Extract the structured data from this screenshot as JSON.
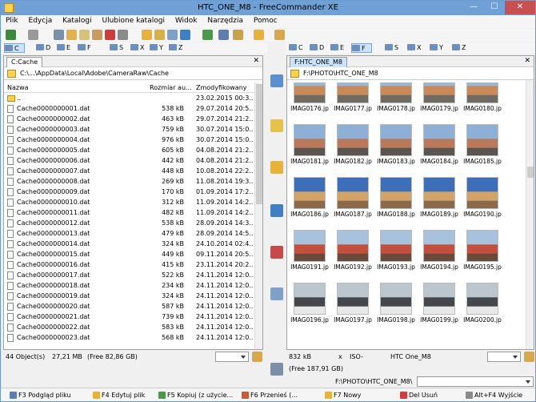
{
  "window": {
    "title": "HTC_ONE_M8 - FreeCommander XE",
    "min": "—",
    "max": "☐",
    "close": "✕"
  },
  "menu": [
    "Plik",
    "Edycja",
    "Katalogi",
    "Ulubione katalogi",
    "Widok",
    "Narzędzia",
    "Pomoc"
  ],
  "drives_left": [
    "C",
    "D",
    "E",
    "F",
    "S",
    "X",
    "Y",
    "Z"
  ],
  "drives_right": [
    "C",
    "D",
    "E",
    "F",
    "S",
    "X",
    "Y",
    "Z"
  ],
  "left": {
    "tab": "C:Cache",
    "path": "C:\\...\\AppData\\Local\\Adobe\\CameraRaw\\Cache",
    "columns": {
      "name": "Nazwa",
      "size": "Rozmiar au...",
      "modified": "Zmodyfikowany"
    },
    "rows": [
      {
        "name": "..",
        "size": "",
        "date": "23.02.2015 00:3..",
        "type": "folder"
      },
      {
        "name": "Cache0000000001.dat",
        "size": "538 kB",
        "date": "29.07.2014 20:5..",
        "type": "file"
      },
      {
        "name": "Cache0000000002.dat",
        "size": "463 kB",
        "date": "29.07.2014 21:2..",
        "type": "file"
      },
      {
        "name": "Cache0000000003.dat",
        "size": "759 kB",
        "date": "30.07.2014 15:0..",
        "type": "file"
      },
      {
        "name": "Cache0000000004.dat",
        "size": "976 kB",
        "date": "30.07.2014 15:0..",
        "type": "file"
      },
      {
        "name": "Cache0000000005.dat",
        "size": "605 kB",
        "date": "04.08.2014 21:2..",
        "type": "file"
      },
      {
        "name": "Cache0000000006.dat",
        "size": "442 kB",
        "date": "04.08.2014 21:2..",
        "type": "file"
      },
      {
        "name": "Cache0000000007.dat",
        "size": "448 kB",
        "date": "10.08.2014 22:2..",
        "type": "file"
      },
      {
        "name": "Cache0000000008.dat",
        "size": "269 kB",
        "date": "11.08.2014 19:3..",
        "type": "file"
      },
      {
        "name": "Cache0000000009.dat",
        "size": "170 kB",
        "date": "01.09.2014 17:2..",
        "type": "file"
      },
      {
        "name": "Cache0000000010.dat",
        "size": "312 kB",
        "date": "11.09.2014 14:2..",
        "type": "file"
      },
      {
        "name": "Cache0000000011.dat",
        "size": "482 kB",
        "date": "11.09.2014 14:2..",
        "type": "file"
      },
      {
        "name": "Cache0000000012.dat",
        "size": "538 kB",
        "date": "28.09.2014 14:3..",
        "type": "file"
      },
      {
        "name": "Cache0000000013.dat",
        "size": "479 kB",
        "date": "28.09.2014 14:5..",
        "type": "file"
      },
      {
        "name": "Cache0000000014.dat",
        "size": "324 kB",
        "date": "24.10.2014 02:4..",
        "type": "file"
      },
      {
        "name": "Cache0000000015.dat",
        "size": "449 kB",
        "date": "09.11.2014 20:5..",
        "type": "file"
      },
      {
        "name": "Cache0000000016.dat",
        "size": "415 kB",
        "date": "23.11.2014 20:2..",
        "type": "file"
      },
      {
        "name": "Cache0000000017.dat",
        "size": "522 kB",
        "date": "24.11.2014 12:0..",
        "type": "file"
      },
      {
        "name": "Cache0000000018.dat",
        "size": "234 kB",
        "date": "24.11.2014 12:0..",
        "type": "file"
      },
      {
        "name": "Cache0000000019.dat",
        "size": "324 kB",
        "date": "24.11.2014 12:0..",
        "type": "file"
      },
      {
        "name": "Cache0000000020.dat",
        "size": "587 kB",
        "date": "24.11.2014 12:0..",
        "type": "file"
      },
      {
        "name": "Cache0000000021.dat",
        "size": "739 kB",
        "date": "24.11.2014 12:0..",
        "type": "file"
      },
      {
        "name": "Cache0000000022.dat",
        "size": "583 kB",
        "date": "24.11.2014 12:0..",
        "type": "file"
      },
      {
        "name": "Cache0000000023.dat",
        "size": "568 kB",
        "date": "24.11.2014 12:0..",
        "type": "file"
      }
    ],
    "status_count": "44 Object(s)",
    "status_size": "27,21 MB",
    "status_free": "(Free 82,86 GB)"
  },
  "right": {
    "tab": "F:HTC_ONE_M8",
    "path": "F:\\PHOTO\\HTC_ONE_M8",
    "thumbs": [
      [
        "IMAG0176.jp",
        "IMAG0177.jp",
        "IMAG0178.jp",
        "IMAG0179.jp",
        "IMAG0180.jp"
      ],
      [
        "IMAG0181.jp",
        "IMAG0182.jp",
        "IMAG0183.jp",
        "IMAG0184.jp",
        "IMAG0185.jp"
      ],
      [
        "IMAG0186.jp",
        "IMAG0187.jp",
        "IMAG0188.jp",
        "IMAG0189.jp",
        "IMAG0190.jp"
      ],
      [
        "IMAG0191.jp",
        "IMAG0192.jp",
        "IMAG0193.jp",
        "IMAG0194.jp",
        "IMAG0195.jp"
      ],
      [
        "IMAG0196.jp",
        "IMAG0197.jp",
        "IMAG0198.jp",
        "IMAG0199.jp",
        "IMAG0200.jp"
      ]
    ],
    "status_size": "832 kB",
    "status_x": "x",
    "status_iso": "ISO-",
    "status_camera": "HTC One_M8",
    "status_free": "(Free 187,91 GB)"
  },
  "cmdline_path": "F:\\PHOTO\\HTC_ONE_M8\\",
  "fkeys": [
    {
      "label": "F3 Podgląd pliku",
      "color": "#5b7fb5"
    },
    {
      "label": "F4 Edytuj plik",
      "color": "#e7b23a"
    },
    {
      "label": "F5 Kopiuj (z użycie...",
      "color": "#4a9a4a"
    },
    {
      "label": "F6 Przenieś (...",
      "color": "#c55b3b"
    },
    {
      "label": "F7 Nowy",
      "color": "#e7b23a"
    },
    {
      "label": "Del Usuń",
      "color": "#d23c3c"
    },
    {
      "label": "Alt+F4 Wyjście",
      "color": "#8a8a8a"
    }
  ]
}
